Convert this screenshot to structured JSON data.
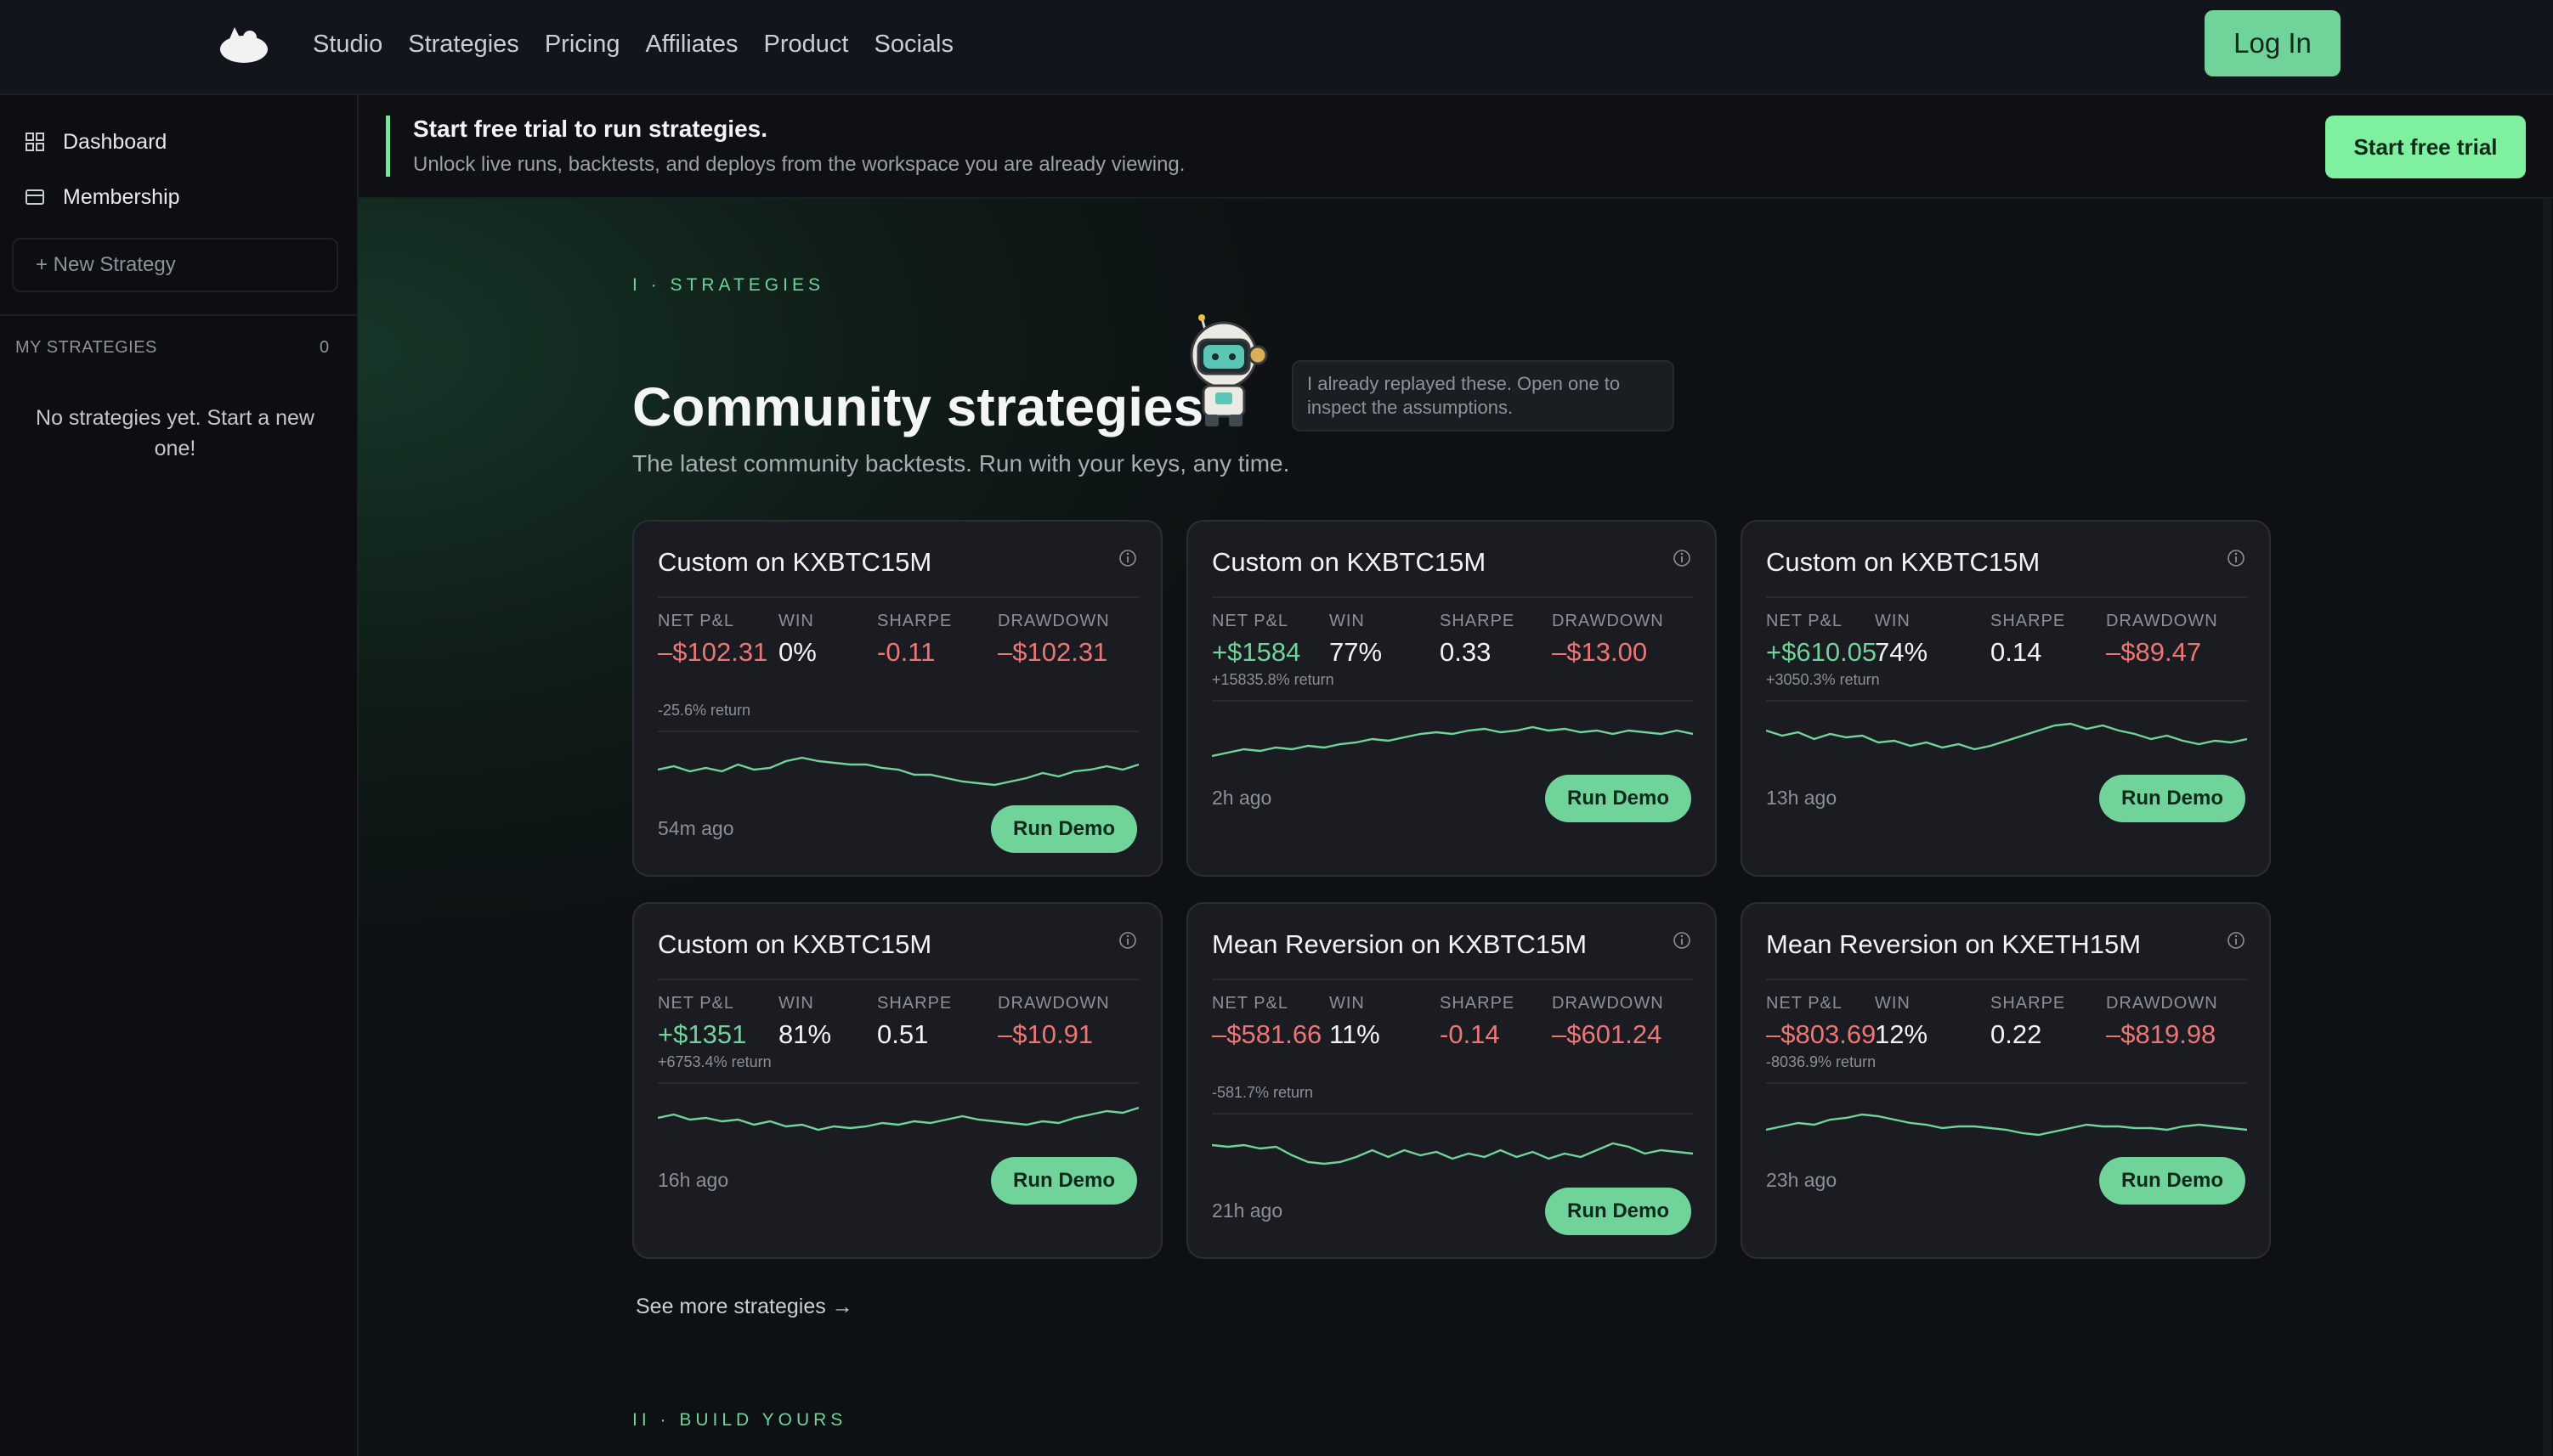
{
  "nav": {
    "links": [
      "Studio",
      "Strategies",
      "Pricing",
      "Affiliates",
      "Product",
      "Socials"
    ],
    "login": "Log In"
  },
  "sidebar": {
    "items": [
      {
        "label": "Dashboard",
        "icon": "grid-icon"
      },
      {
        "label": "Membership",
        "icon": "card-icon"
      }
    ],
    "new_strategy": "+ New Strategy",
    "my_strategies_label": "MY STRATEGIES",
    "my_strategies_count": "0",
    "empty_message": "No strategies yet. Start a new one!"
  },
  "banner": {
    "title": "Start free trial to run strategies.",
    "subtitle": "Unlock live runs, backtests, and deploys from the workspace you are already viewing.",
    "cta": "Start free trial"
  },
  "section1": {
    "label": "I · STRATEGIES",
    "heading": "Community strategies.",
    "subheading": "The latest community backtests. Run with your keys, any time.",
    "bubble": "I already replayed these. Open one to inspect the assumptions."
  },
  "stat_labels": {
    "pnl": "NET P&L",
    "win": "WIN",
    "sharpe": "SHARPE",
    "drawdown": "DRAWDOWN"
  },
  "cards": [
    {
      "title": "Custom on KXBTC15M",
      "pnl": "–$102.31",
      "pnl_sign": "neg",
      "ret": "-25.6% return",
      "win": "0%",
      "sharpe": "-0.11",
      "sharpe_sign": "neg",
      "drawdown": "–$102.31",
      "ago": "54m ago",
      "cta": "Run Demo",
      "spark": [
        30,
        34,
        28,
        32,
        28,
        36,
        30,
        32,
        40,
        44,
        40,
        38,
        36,
        36,
        32,
        30,
        24,
        24,
        20,
        16,
        14,
        12,
        16,
        20,
        26,
        22,
        28,
        30,
        34,
        30,
        36
      ]
    },
    {
      "title": "Custom on KXBTC15M",
      "pnl": "+$1584",
      "pnl_sign": "pos",
      "ret": "+15835.8% return",
      "win": "77%",
      "sharpe": "0.33",
      "sharpe_sign": "",
      "drawdown": "–$13.00",
      "ago": "2h ago",
      "cta": "Run Demo",
      "spark": [
        10,
        14,
        18,
        16,
        20,
        18,
        22,
        20,
        24,
        26,
        30,
        28,
        32,
        36,
        38,
        36,
        40,
        42,
        38,
        40,
        44,
        40,
        42,
        38,
        40,
        36,
        40,
        38,
        36,
        40,
        36
      ]
    },
    {
      "title": "Custom on KXBTC15M",
      "pnl": "+$610.05",
      "pnl_sign": "pos",
      "ret": "+3050.3% return",
      "win": "74%",
      "sharpe": "0.14",
      "sharpe_sign": "",
      "drawdown": "–$89.47",
      "ago": "13h ago",
      "cta": "Run Demo",
      "spark": [
        40,
        34,
        38,
        30,
        36,
        32,
        34,
        26,
        28,
        22,
        26,
        20,
        24,
        18,
        22,
        28,
        34,
        40,
        46,
        48,
        42,
        46,
        40,
        36,
        30,
        34,
        28,
        24,
        28,
        26,
        30
      ]
    },
    {
      "title": "Custom on KXBTC15M",
      "pnl": "+$1351",
      "pnl_sign": "pos",
      "ret": "+6753.4% return",
      "win": "81%",
      "sharpe": "0.51",
      "sharpe_sign": "",
      "drawdown": "–$10.91",
      "ago": "16h ago",
      "cta": "Run Demo",
      "spark": [
        34,
        38,
        32,
        34,
        30,
        32,
        26,
        30,
        24,
        26,
        20,
        24,
        22,
        24,
        28,
        26,
        30,
        28,
        32,
        36,
        32,
        30,
        28,
        26,
        30,
        28,
        34,
        38,
        42,
        40,
        46
      ]
    },
    {
      "title": "Mean Reversion on KXBTC15M",
      "pnl": "–$581.66",
      "pnl_sign": "neg",
      "ret": "-581.7% return",
      "win": "11%",
      "sharpe": "-0.14",
      "sharpe_sign": "neg",
      "drawdown": "–$601.24",
      "ago": "21h ago",
      "cta": "Run Demo",
      "spark": [
        38,
        36,
        38,
        34,
        36,
        26,
        18,
        16,
        18,
        24,
        32,
        24,
        32,
        26,
        30,
        22,
        28,
        24,
        32,
        24,
        30,
        22,
        28,
        24,
        32,
        40,
        36,
        28,
        32,
        30,
        28
      ]
    },
    {
      "title": "Mean Reversion on KXETH15M",
      "pnl": "–$803.69",
      "pnl_sign": "neg",
      "ret": "-8036.9% return",
      "win": "12%",
      "sharpe": "0.22",
      "sharpe_sign": "",
      "drawdown": "–$819.98",
      "ago": "23h ago",
      "cta": "Run Demo",
      "spark": [
        20,
        24,
        28,
        26,
        32,
        34,
        38,
        36,
        32,
        28,
        26,
        22,
        24,
        24,
        22,
        20,
        16,
        14,
        18,
        22,
        26,
        24,
        24,
        22,
        22,
        20,
        24,
        26,
        24,
        22,
        20
      ]
    }
  ],
  "see_more": "See more strategies  →",
  "section2": {
    "label": "II · BUILD YOURS"
  },
  "colors": {
    "accent": "#6fd39a",
    "negative": "#ef7474",
    "card": "#1a1c21"
  }
}
